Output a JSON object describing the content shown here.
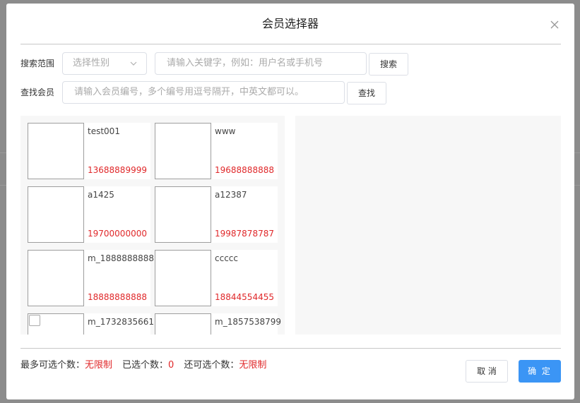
{
  "dialog": {
    "title": "会员选择器"
  },
  "search": {
    "range_label": "搜索范围",
    "gender_placeholder": "选择性别",
    "keyword_placeholder": "请输入关键字，例如：用户名或手机号",
    "search_button": "搜索",
    "find_label": "查找会员",
    "find_placeholder": "请输入会员编号，多个编号用逗号隔开，中英文都可以。",
    "find_button": "查找"
  },
  "members": [
    {
      "name": "test001",
      "phone": "13688889999"
    },
    {
      "name": "www",
      "phone": "19688888888"
    },
    {
      "name": "a1425",
      "phone": "19700000000"
    },
    {
      "name": "a12387",
      "phone": "19987878787"
    },
    {
      "name": "m_1888888888",
      "phone": "18888888888"
    },
    {
      "name": "ccccc",
      "phone": "18844554455"
    },
    {
      "name": "m_1732835661",
      "phone": ""
    },
    {
      "name": "m_1857538799",
      "phone": ""
    }
  ],
  "footer": {
    "max_label": "最多可选个数：",
    "max_value": "无限制",
    "selected_label": "已选个数：",
    "selected_value": "0",
    "remaining_label": "还可选个数：",
    "remaining_value": "无限制",
    "cancel_button": "取 消",
    "confirm_button": "确 定"
  },
  "colors": {
    "accent": "#3b95f5",
    "phone_red": "#e0282a"
  },
  "icons": {
    "close": "close-icon",
    "dropdown": "chevron-down-icon"
  }
}
